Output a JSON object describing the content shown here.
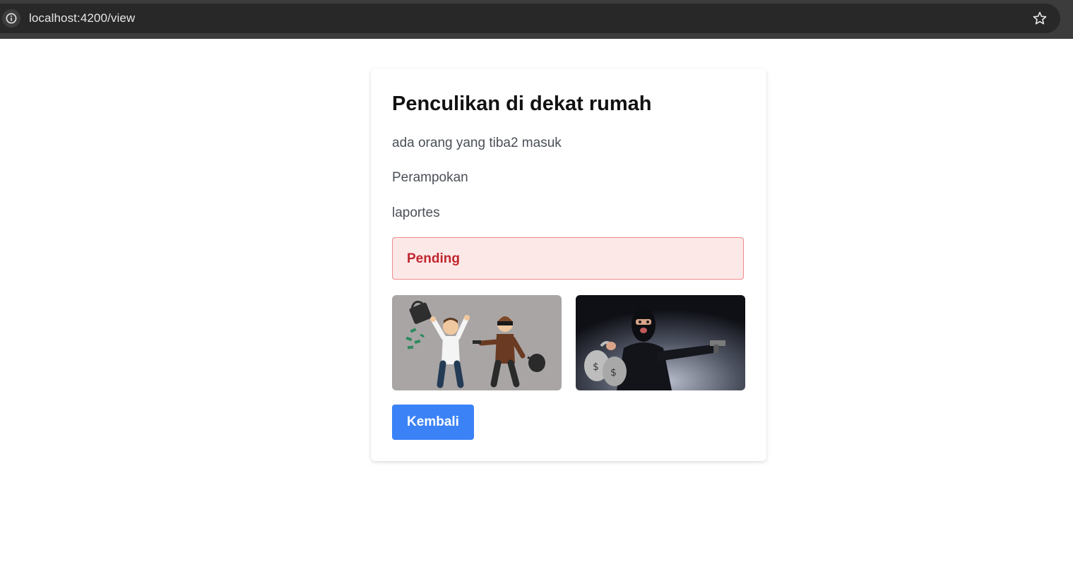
{
  "browser": {
    "url": "localhost:4200/view",
    "icons": [
      "info-icon",
      "star-icon"
    ]
  },
  "report": {
    "title": "Penculikan di dekat rumah",
    "description": "ada orang yang tiba2 masuk",
    "category": "Perampokan",
    "reporter": "laportes",
    "status": "Pending",
    "images": [
      "robbery-illustration",
      "masked-robber-photo"
    ]
  },
  "actions": {
    "back_label": "Kembali"
  },
  "colors": {
    "status_bg": "#fde8e8",
    "status_border": "#ef8b8b",
    "status_text": "#c0262d",
    "button_bg": "#3b82f6"
  }
}
